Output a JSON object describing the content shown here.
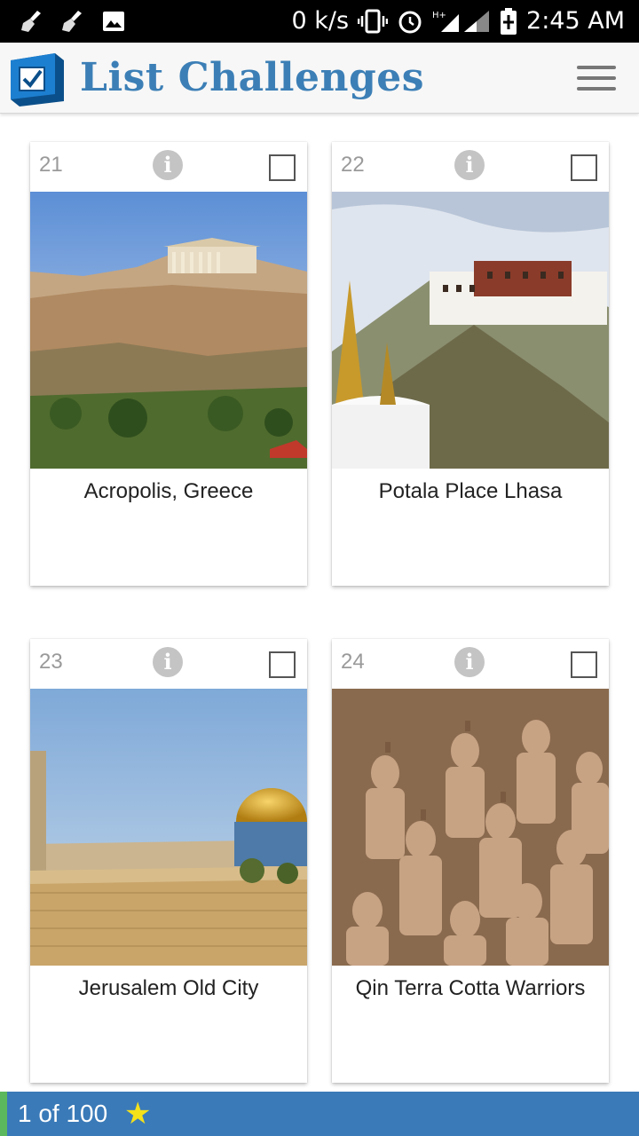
{
  "status_bar": {
    "net_speed": "0 k/s",
    "time": "2:45 AM",
    "icons": [
      "broom-icon",
      "broom-icon",
      "image-icon",
      "vibrate-icon",
      "alarm-icon",
      "signal-icon",
      "battery-charging-icon"
    ]
  },
  "app": {
    "title": "List Challenges",
    "brand_color": "#3c7fb6"
  },
  "cards": [
    {
      "number": "21",
      "title": "Acropolis, Greece",
      "checked": false
    },
    {
      "number": "22",
      "title": "Potala Place Lhasa",
      "checked": false
    },
    {
      "number": "23",
      "title": "Jerusalem Old City",
      "checked": false
    },
    {
      "number": "24",
      "title": "Qin Terra Cotta Warriors",
      "checked": false
    }
  ],
  "bottom_bar": {
    "progress": "1 of 100",
    "color": "#3a7ab8",
    "star_color": "#f5e11a"
  }
}
